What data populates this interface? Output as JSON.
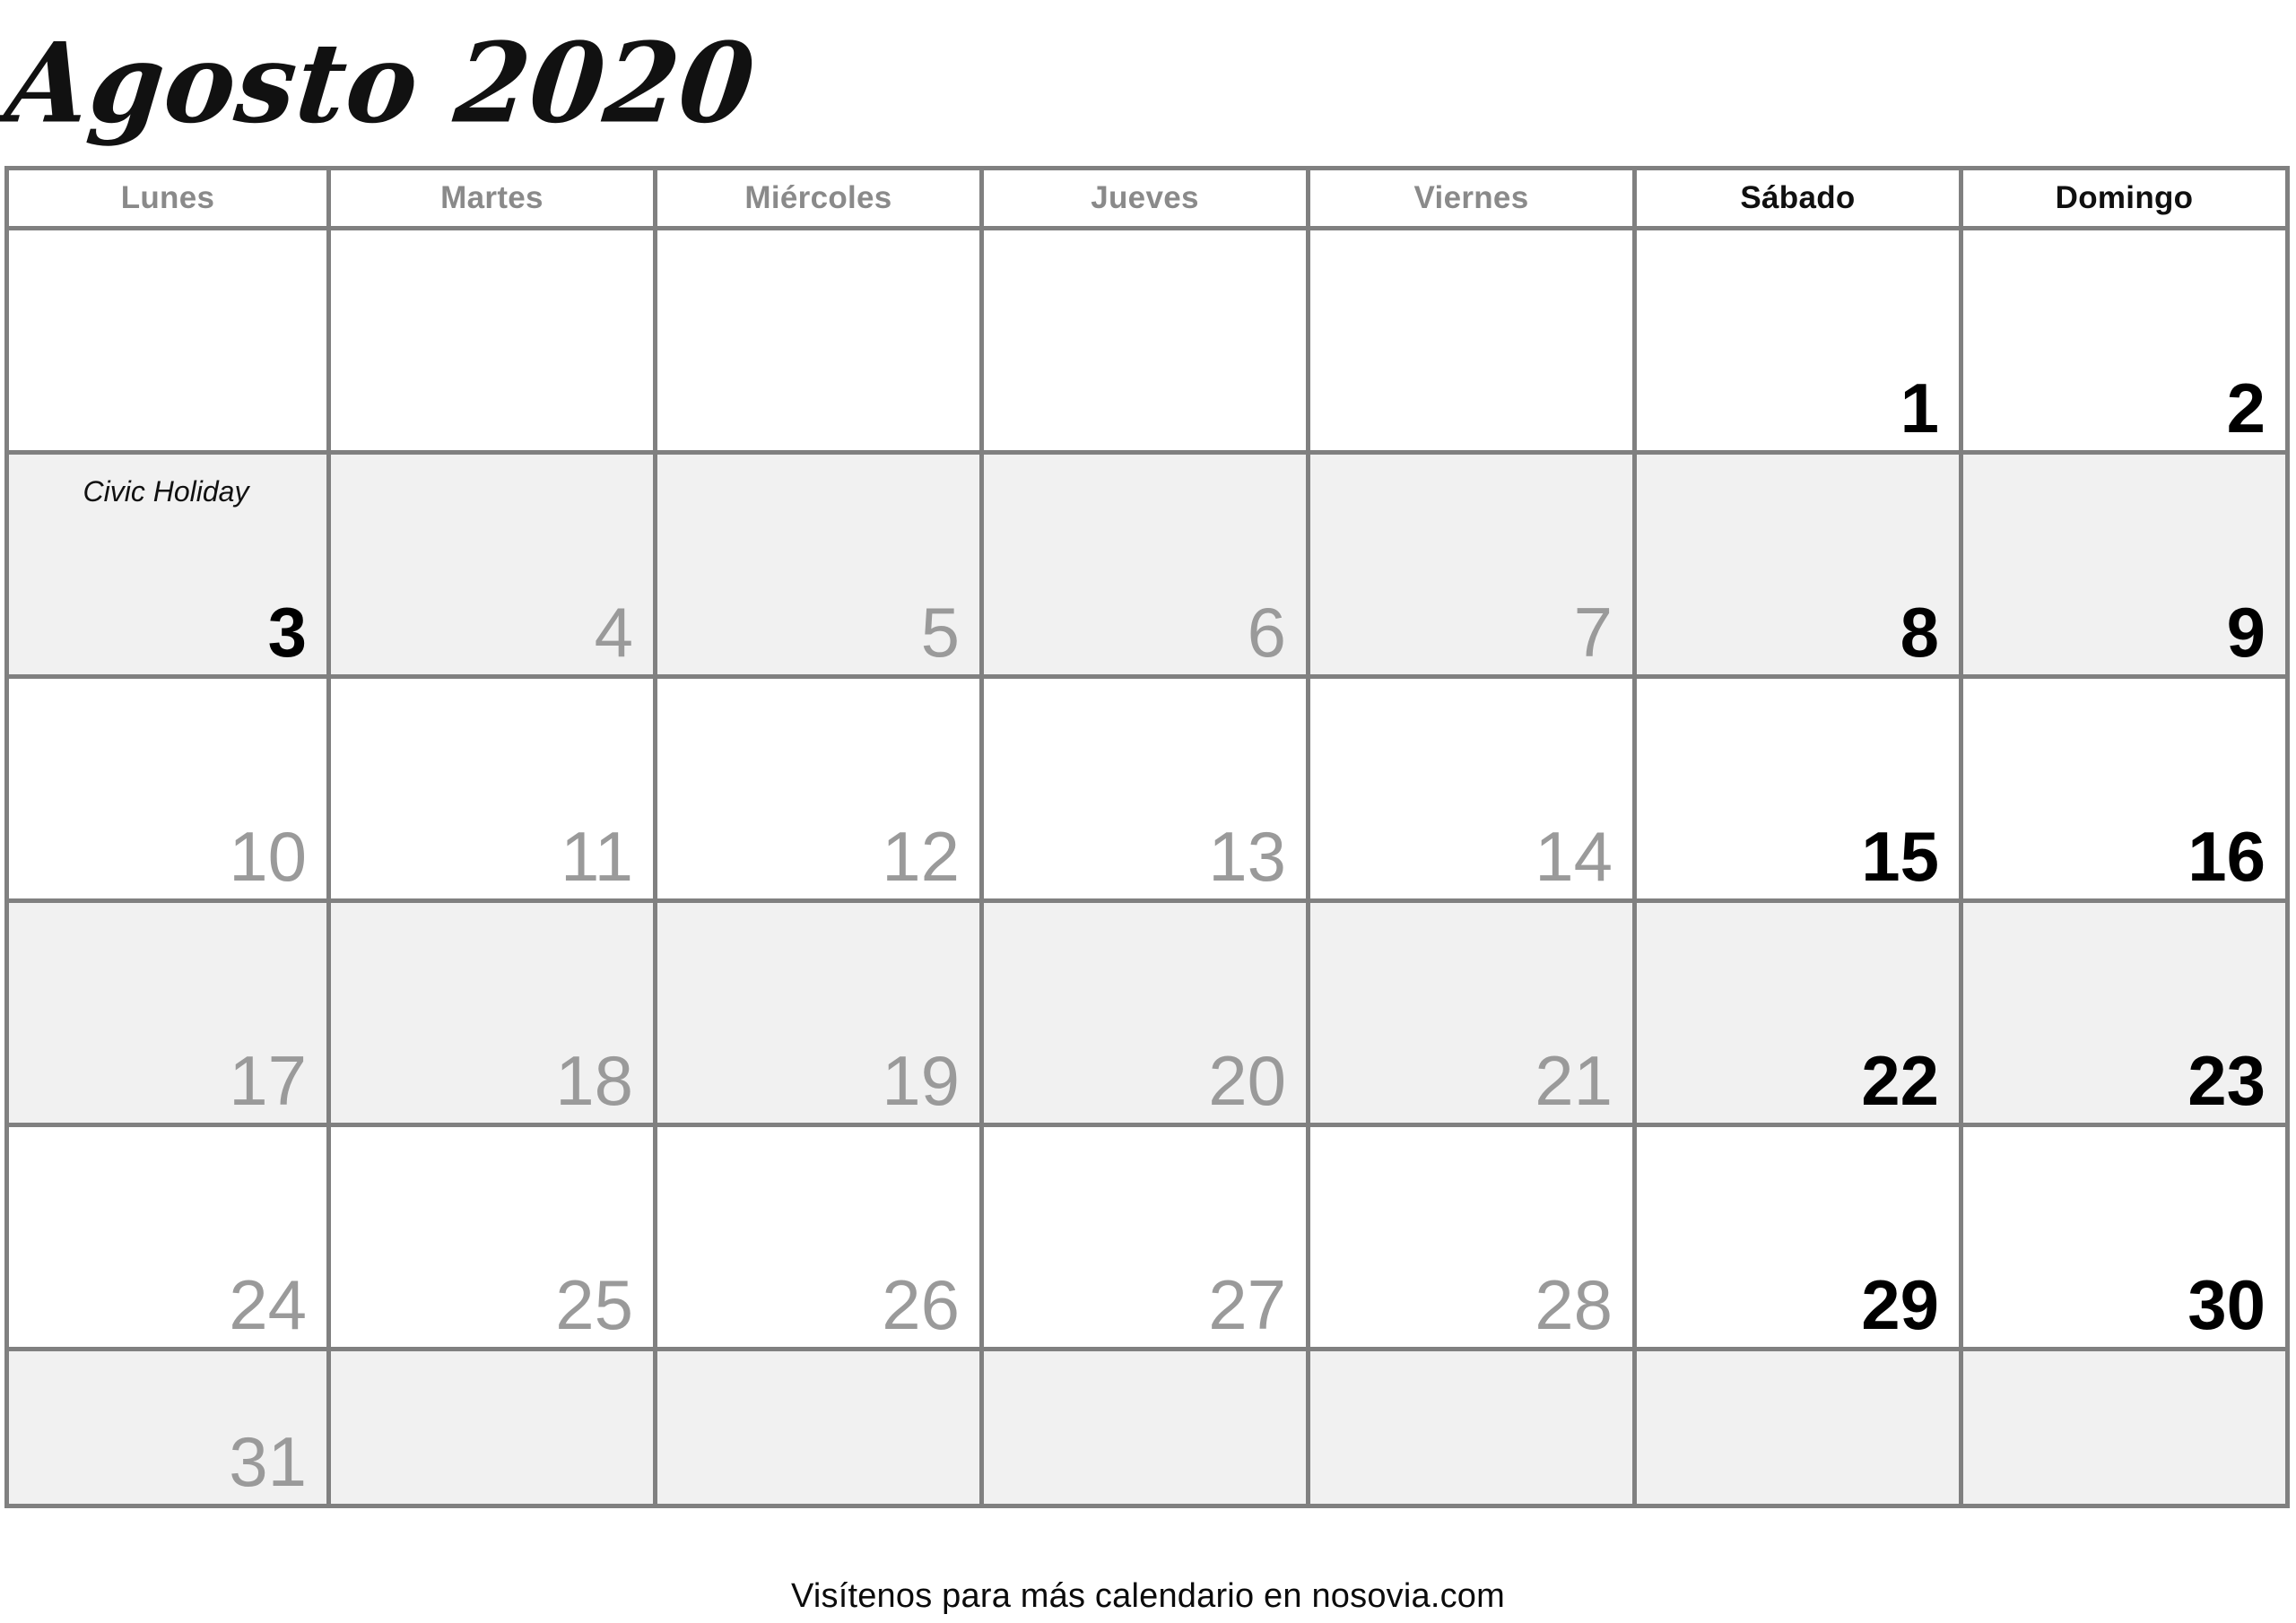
{
  "header": {
    "month_title": "Agosto 2020"
  },
  "weekday_headers": [
    {
      "label": "Lunes",
      "weekend": false
    },
    {
      "label": "Martes",
      "weekend": false
    },
    {
      "label": "Miércoles",
      "weekend": false
    },
    {
      "label": "Jueves",
      "weekend": false
    },
    {
      "label": "Viernes",
      "weekend": false
    },
    {
      "label": "Sábado",
      "weekend": true
    },
    {
      "label": "Domingo",
      "weekend": true
    }
  ],
  "colors": {
    "grid_line": "#808080",
    "shaded_row_bg": "#f1f1f1",
    "plain_row_bg": "#ffffff",
    "weekday_number": "#9a9a9a",
    "weekend_number": "#000000",
    "weekday_header": "#8a8a8a",
    "weekend_header": "#101010"
  },
  "weeks": [
    {
      "shaded": false,
      "days": [
        {
          "number": "",
          "type": "empty",
          "event": ""
        },
        {
          "number": "",
          "type": "empty",
          "event": ""
        },
        {
          "number": "",
          "type": "empty",
          "event": ""
        },
        {
          "number": "",
          "type": "empty",
          "event": ""
        },
        {
          "number": "",
          "type": "empty",
          "event": ""
        },
        {
          "number": "1",
          "type": "weekend",
          "event": ""
        },
        {
          "number": "2",
          "type": "weekend",
          "event": ""
        }
      ]
    },
    {
      "shaded": true,
      "days": [
        {
          "number": "3",
          "type": "holiday",
          "event": "Civic Holiday"
        },
        {
          "number": "4",
          "type": "weekday",
          "event": ""
        },
        {
          "number": "5",
          "type": "weekday",
          "event": ""
        },
        {
          "number": "6",
          "type": "weekday",
          "event": ""
        },
        {
          "number": "7",
          "type": "weekday",
          "event": ""
        },
        {
          "number": "8",
          "type": "weekend",
          "event": ""
        },
        {
          "number": "9",
          "type": "weekend",
          "event": ""
        }
      ]
    },
    {
      "shaded": false,
      "days": [
        {
          "number": "10",
          "type": "weekday",
          "event": ""
        },
        {
          "number": "11",
          "type": "weekday",
          "event": ""
        },
        {
          "number": "12",
          "type": "weekday",
          "event": ""
        },
        {
          "number": "13",
          "type": "weekday",
          "event": ""
        },
        {
          "number": "14",
          "type": "weekday",
          "event": ""
        },
        {
          "number": "15",
          "type": "weekend",
          "event": ""
        },
        {
          "number": "16",
          "type": "weekend",
          "event": ""
        }
      ]
    },
    {
      "shaded": true,
      "days": [
        {
          "number": "17",
          "type": "weekday",
          "event": ""
        },
        {
          "number": "18",
          "type": "weekday",
          "event": ""
        },
        {
          "number": "19",
          "type": "weekday",
          "event": ""
        },
        {
          "number": "20",
          "type": "weekday",
          "event": ""
        },
        {
          "number": "21",
          "type": "weekday",
          "event": ""
        },
        {
          "number": "22",
          "type": "weekend",
          "event": ""
        },
        {
          "number": "23",
          "type": "weekend",
          "event": ""
        }
      ]
    },
    {
      "shaded": false,
      "days": [
        {
          "number": "24",
          "type": "weekday",
          "event": ""
        },
        {
          "number": "25",
          "type": "weekday",
          "event": ""
        },
        {
          "number": "26",
          "type": "weekday",
          "event": ""
        },
        {
          "number": "27",
          "type": "weekday",
          "event": ""
        },
        {
          "number": "28",
          "type": "weekday",
          "event": ""
        },
        {
          "number": "29",
          "type": "weekend",
          "event": ""
        },
        {
          "number": "30",
          "type": "weekend",
          "event": ""
        }
      ]
    },
    {
      "shaded": true,
      "last": true,
      "days": [
        {
          "number": "31",
          "type": "weekday",
          "event": ""
        },
        {
          "number": "",
          "type": "empty",
          "event": ""
        },
        {
          "number": "",
          "type": "empty",
          "event": ""
        },
        {
          "number": "",
          "type": "empty",
          "event": ""
        },
        {
          "number": "",
          "type": "empty",
          "event": ""
        },
        {
          "number": "",
          "type": "empty",
          "event": ""
        },
        {
          "number": "",
          "type": "empty",
          "event": ""
        }
      ]
    }
  ],
  "footer": {
    "text": "Visítenos para más calendario en nosovia.com"
  }
}
